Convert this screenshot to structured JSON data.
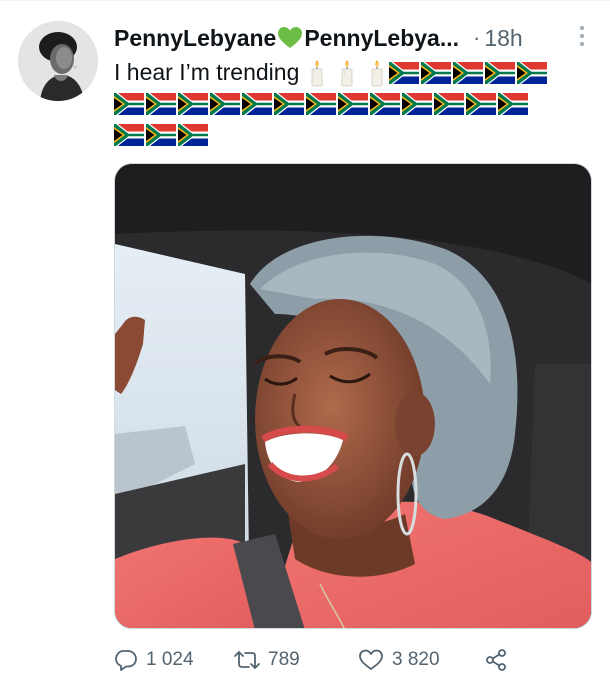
{
  "tweet": {
    "author": {
      "display_name": "PennyLebyane",
      "handle": "PennyLebya...",
      "verified_emoji": "green-heart-icon"
    },
    "separator": "·",
    "time": "18h",
    "text": "I hear I’m trending",
    "emoji": {
      "candles_count": 3,
      "candle_icon": "candle-icon",
      "flag_icon": "south-africa-flag-icon",
      "flags_line1": 5,
      "flags_line2": 13,
      "flags_line3": 3
    },
    "media": {
      "type": "video-still",
      "description_icon": "photo-media"
    },
    "actions": {
      "replies": "1 024",
      "retweets": "789",
      "likes": "3 820"
    }
  },
  "colors": {
    "text_primary": "#0f1419",
    "text_secondary": "#536471",
    "heart_green": "#6cbd45",
    "border": "#cfd9de"
  }
}
